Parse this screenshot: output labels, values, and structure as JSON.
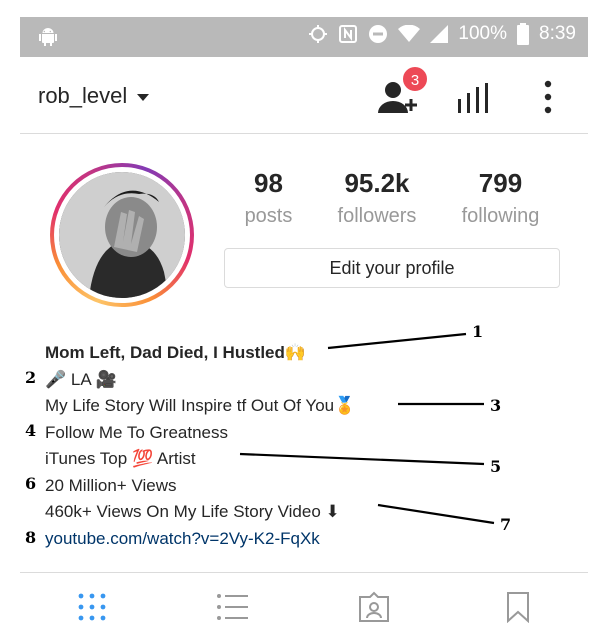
{
  "status_bar": {
    "battery": "100%",
    "time": "8:39",
    "icons": [
      "android-icon",
      "location-icon",
      "nfc-icon",
      "dnd-icon",
      "wifi-icon",
      "signal-icon",
      "battery-icon"
    ]
  },
  "header": {
    "username": "rob_level",
    "notification_count": "3"
  },
  "profile": {
    "stats": [
      {
        "value": "98",
        "label": "posts"
      },
      {
        "value": "95.2k",
        "label": "followers"
      },
      {
        "value": "799",
        "label": "following"
      }
    ],
    "edit_button": "Edit your profile"
  },
  "bio": {
    "lines": [
      "Mom Left, Dad Died, I Hustled🙌",
      "🎤 LA 🎥",
      "My Life Story Will Inspire tf Out Of You🏅",
      "Follow Me To Greatness",
      "iTunes Top 💯 Artist",
      "20 Million+ Views",
      "460k+ Views On My Life Story Video ⬇",
      "youtube.com/watch?v=2Vy-K2-FqXk"
    ]
  },
  "annotations": [
    "1",
    "2",
    "3",
    "4",
    "5",
    "6",
    "7",
    "8"
  ],
  "colors": {
    "badge": "#ed4956",
    "link": "#003569",
    "muted": "#999999",
    "tab_active": "#3897f0"
  }
}
